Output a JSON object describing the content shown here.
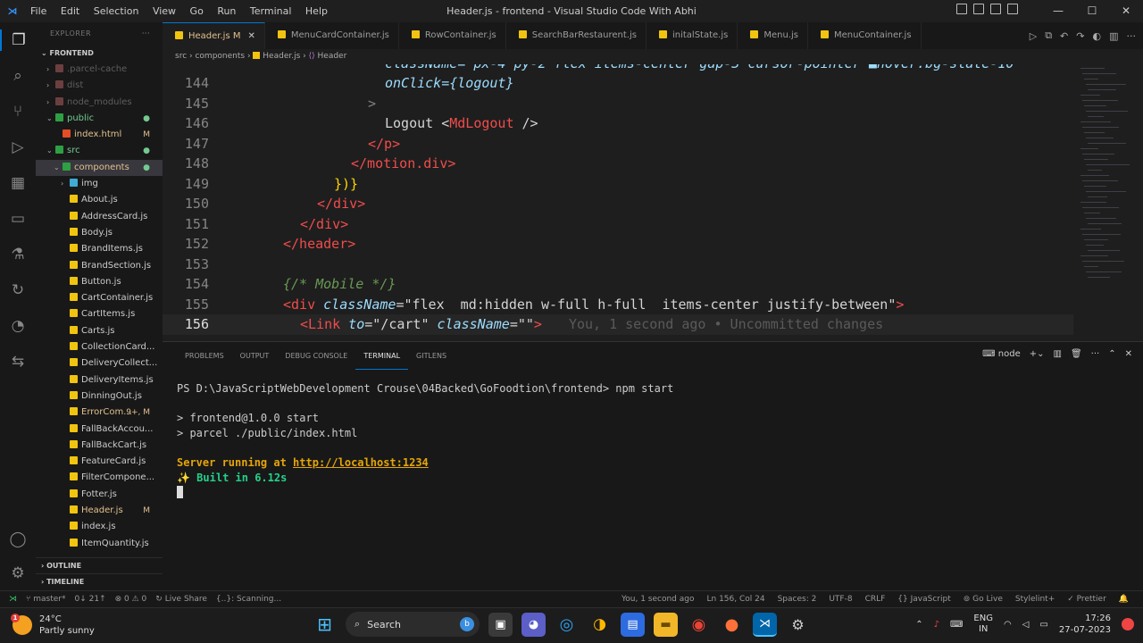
{
  "window": {
    "title": "Header.js - frontend - Visual Studio Code With Abhi",
    "menu": [
      "File",
      "Edit",
      "Selection",
      "View",
      "Go",
      "Run",
      "Terminal",
      "Help"
    ]
  },
  "sidebar": {
    "explorer_label": "EXPLORER",
    "root": "FRONTEND",
    "items": [
      {
        "label": ".parcel-cache",
        "kind": "folder",
        "depth": 1,
        "color": "#5e5e5e"
      },
      {
        "label": "dist",
        "kind": "folder",
        "depth": 1,
        "color": "#5e5e5e"
      },
      {
        "label": "node_modules",
        "kind": "folder",
        "depth": 1,
        "color": "#5e5e5e"
      },
      {
        "label": "public",
        "kind": "folder-open",
        "depth": 1,
        "color": "#73c991",
        "status": "●"
      },
      {
        "label": "index.html",
        "kind": "html",
        "depth": 2,
        "color": "#e2c08d",
        "status": "M"
      },
      {
        "label": "src",
        "kind": "folder-open",
        "depth": 1,
        "color": "#73c991",
        "status": "●"
      },
      {
        "label": "components",
        "kind": "folder-open",
        "depth": 2,
        "color": "#e2c08d",
        "status": "●",
        "selected": true
      },
      {
        "label": "img",
        "kind": "folder",
        "depth": 3,
        "color": "#cccccc"
      },
      {
        "label": "About.js",
        "kind": "js",
        "depth": 3,
        "color": "#cccccc"
      },
      {
        "label": "AddressCard.js",
        "kind": "js",
        "depth": 3,
        "color": "#cccccc"
      },
      {
        "label": "Body.js",
        "kind": "js",
        "depth": 3,
        "color": "#cccccc"
      },
      {
        "label": "BrandItems.js",
        "kind": "js",
        "depth": 3,
        "color": "#cccccc"
      },
      {
        "label": "BrandSection.js",
        "kind": "js",
        "depth": 3,
        "color": "#cccccc"
      },
      {
        "label": "Button.js",
        "kind": "js",
        "depth": 3,
        "color": "#cccccc"
      },
      {
        "label": "CartContainer.js",
        "kind": "js",
        "depth": 3,
        "color": "#cccccc"
      },
      {
        "label": "CartItems.js",
        "kind": "js",
        "depth": 3,
        "color": "#cccccc"
      },
      {
        "label": "Carts.js",
        "kind": "js",
        "depth": 3,
        "color": "#cccccc"
      },
      {
        "label": "CollectionCard...",
        "kind": "js",
        "depth": 3,
        "color": "#cccccc"
      },
      {
        "label": "DeliveryCollect...",
        "kind": "js",
        "depth": 3,
        "color": "#cccccc"
      },
      {
        "label": "DeliveryItems.js",
        "kind": "js",
        "depth": 3,
        "color": "#cccccc"
      },
      {
        "label": "DinningOut.js",
        "kind": "js",
        "depth": 3,
        "color": "#cccccc"
      },
      {
        "label": "ErrorCom...",
        "kind": "js",
        "depth": 3,
        "color": "#e2c08d",
        "status": "9+, M"
      },
      {
        "label": "FallBackAccou...",
        "kind": "js",
        "depth": 3,
        "color": "#cccccc"
      },
      {
        "label": "FallBackCart.js",
        "kind": "js",
        "depth": 3,
        "color": "#cccccc"
      },
      {
        "label": "FeatureCard.js",
        "kind": "js",
        "depth": 3,
        "color": "#cccccc"
      },
      {
        "label": "FilterCompone...",
        "kind": "js",
        "depth": 3,
        "color": "#cccccc"
      },
      {
        "label": "Fotter.js",
        "kind": "js",
        "depth": 3,
        "color": "#cccccc"
      },
      {
        "label": "Header.js",
        "kind": "js",
        "depth": 3,
        "color": "#e2c08d",
        "status": "M"
      },
      {
        "label": "index.js",
        "kind": "js",
        "depth": 3,
        "color": "#cccccc"
      },
      {
        "label": "ItemQuantity.js",
        "kind": "js",
        "depth": 3,
        "color": "#cccccc"
      }
    ],
    "outline": "OUTLINE",
    "timeline": "TIMELINE"
  },
  "tabs": [
    {
      "label": "Header.js",
      "badge": "M",
      "active": true
    },
    {
      "label": "MenuCardContainer.js"
    },
    {
      "label": "RowContainer.js"
    },
    {
      "label": "SearchBarRestaurent.js"
    },
    {
      "label": "initalState.js"
    },
    {
      "label": "Menu.js"
    },
    {
      "label": "MenuContainer.js"
    }
  ],
  "breadcrumb": {
    "a": "src",
    "b": "components",
    "c": "Header.js",
    "d": "Header"
  },
  "editor": {
    "top_partial": "className=\"px-4 py-2 flex items-center gap-3 cursor-pointer ■hover:bg-slate-10",
    "lines": {
      "144": "onClick={logout}",
      "145": ">",
      "146a": "Logout <",
      "146b": "MdLogout",
      "146c": " />",
      "147": "</p>",
      "148": "</motion.div>",
      "149": "})}",
      "150": "</div>",
      "151": "</div>",
      "152": "</header>",
      "154": "{/* Mobile */}",
      "155a": "<div ",
      "155b": "className",
      "155c": "=",
      "155d": "\"flex  md:hidden w-full h-full  items-center justify-between\"",
      "155e": ">",
      "156a": "<",
      "156b": "Link",
      "156c": " to",
      "156d": "=",
      "156e": "\"/cart\"",
      "156f": " className",
      "156g": "=",
      "156h": "\"\"",
      "156i": ">",
      "blame": "You, 1 second ago • Uncommitted changes"
    },
    "numbers": [
      "144",
      "145",
      "146",
      "147",
      "148",
      "149",
      "150",
      "151",
      "152",
      "153",
      "154",
      "155",
      "156"
    ]
  },
  "panel": {
    "tabs": [
      "PROBLEMS",
      "OUTPUT",
      "DEBUG CONSOLE",
      "TERMINAL",
      "GITLENS"
    ],
    "shell": "node",
    "terminal": {
      "prompt": "PS D:\\JavaScriptWebDevelopment Crouse\\04Backed\\GoFoodtion\\frontend>",
      "cmd": " npm start",
      "l1": "> frontend@1.0.0 start",
      "l2": "> parcel ./public/index.html",
      "server": "Server running at ",
      "url": "http://localhost:1234",
      "built": "✨ Built in 6.12s"
    }
  },
  "status": {
    "branch": "master*",
    "sync": "0↓ 21↑",
    "errors": "⊗ 0 ⚠ 0",
    "liveshare": "Live Share",
    "scanning": "{..}: Scanning...",
    "blame": "You, 1 second ago",
    "pos": "Ln 156, Col 24",
    "spaces": "Spaces: 2",
    "enc": "UTF-8",
    "eol": "CRLF",
    "lang": "{} JavaScript",
    "golive": "Go Live",
    "stylelint": "Stylelint+",
    "prettier": "✓ Prettier"
  },
  "taskbar": {
    "temp": "24°C",
    "weather": "Partly sunny",
    "weather_badge": "1",
    "search": "Search",
    "lang1": "ENG",
    "lang2": "IN",
    "time": "17:26",
    "date": "27-07-2023"
  }
}
